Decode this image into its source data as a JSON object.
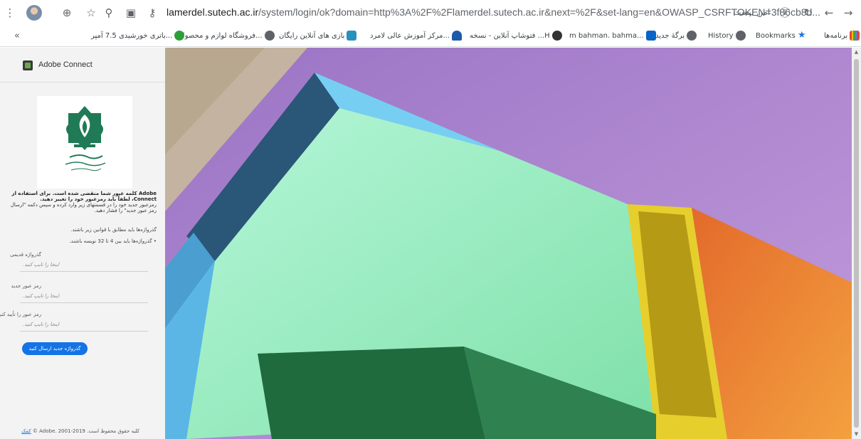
{
  "browser": {
    "url_host": "lamerdel.sutech.ac.ir",
    "url_rest": "/system/login/ok?domain=http%3A%2F%2Flamerdel.sutech.ac.ir&next=%2F&set-lang=en&OWASP_CSRFTOKEN=3f86cb8d...",
    "security_label": "امن نیست",
    "icons": [
      "menu-icon",
      "avatar",
      "globe-icon",
      "star-icon",
      "search-icon",
      "screen-share-icon",
      "key-icon",
      "info-icon",
      "reload-icon",
      "back-icon",
      "forward-icon"
    ]
  },
  "bookmarks": {
    "overflow": "«",
    "items": [
      {
        "label": "برنامه‌ها",
        "icon": "apps-icon",
        "color": "#4285f4"
      },
      {
        "label": "Bookmarks",
        "icon": "star-icon",
        "color": "#1a73e8"
      },
      {
        "label": "History",
        "icon": "globe-icon",
        "color": "#5f6368"
      },
      {
        "label": "برگهٔ جدید",
        "icon": "globe-icon",
        "color": "#5f6368"
      },
      {
        "label": "m bahman. bahma...",
        "icon": "outlook-icon",
        "color": "#0a64c7"
      },
      {
        "label": "فتوشاپ آنلاین - نسخه ...H",
        "icon": "photoshop-icon",
        "color": "#333333"
      },
      {
        "label": "مرکز آموزش عالی لامرد...",
        "icon": "university-icon",
        "color": "#1e5aa8"
      },
      {
        "label": "بازی های آنلاین رایگان",
        "icon": "game-icon",
        "color": "#2a8fbd"
      },
      {
        "label": "فروشگاه لوازم و محصولا...",
        "icon": "globe-icon",
        "color": "#5f6368"
      },
      {
        "label": "باتری خورشیدی 7.5 آمپر...",
        "icon": "battery-icon",
        "color": "#2e9e3a"
      }
    ]
  },
  "panel": {
    "app_title": "Adobe Connect",
    "message_bold": "Adobe کلمه عبور شما منقضی شده است. برای استفاده از Connect، لطفاً باید رمزعبور خود را تغییر دهید.",
    "message_normal": "رمزعبور جدید خود را در قسمتهای زیر وارد کرده و سپس دکمه \"ارسال رمز عبور جدید\" را فشار دهید.",
    "rule_intro": "گذرواژه‌ها باید مطابق با قوانین زیر باشند.",
    "rule_item": "گذرواژه‌ها باید بین 4 تا 32 نویسه باشند.",
    "fields": [
      {
        "label": "گذرواژه قدیمی",
        "placeholder": "اینجا را تایپ کنید."
      },
      {
        "label": "رمز عبور جدید",
        "placeholder": "اینجا را تایپ کنید."
      },
      {
        "label": "رمز عبور را تأیید کنید",
        "placeholder": "اینجا را تایپ کنید."
      }
    ],
    "submit_label": "گذرواژه جدید ارسال کنید",
    "copyright_text": "کلیه حقوق محفوظ است. Adobe. 2001-2019 ©",
    "copyright_link": "کمک"
  }
}
